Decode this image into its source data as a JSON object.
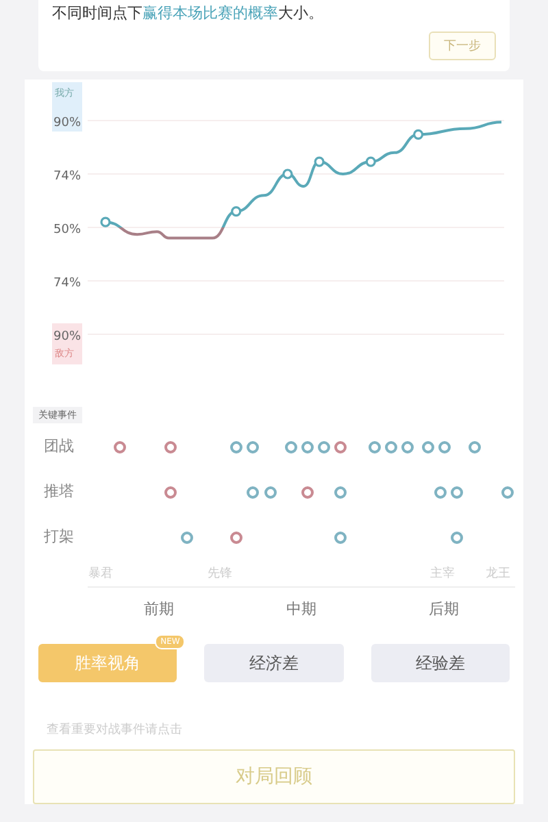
{
  "intro": {
    "text": "不同时间点下**赢得本场比赛的概率**大小。",
    "next_button": "下一步"
  },
  "win_chart": {
    "top_label": "我方",
    "bottom_label": "敌方",
    "axis_labels": [
      "90%",
      "74%",
      "50%",
      "74%",
      "90%"
    ]
  },
  "events": {
    "title": "关键事件",
    "rows": [
      {
        "label": "团战",
        "dots": [
          {
            "color": "#c98a92"
          },
          {
            "color": "#c98a92"
          },
          {
            "color": "#7fb3c2"
          },
          {
            "color": "#7fb3c2"
          },
          {
            "color": "#7fb3c2"
          },
          {
            "color": "#7fb3c2"
          },
          {
            "color": "#7fb3c2"
          },
          {
            "color": "#c98a92"
          },
          {
            "color": "#7fb3c2"
          },
          {
            "color": "#7fb3c2"
          },
          {
            "color": "#7fb3c2"
          },
          {
            "color": "#7fb3c2"
          },
          {
            "color": "#7fb3c2"
          },
          {
            "color": "#7fb3c2"
          }
        ]
      },
      {
        "label": "推塔",
        "dots": [
          {
            "color": "#c98a92"
          },
          {
            "color": "#7fb3c2"
          },
          {
            "color": "#7fb3c2"
          },
          {
            "color": "#c98a92"
          },
          {
            "color": "#7fb3c2"
          },
          {
            "color": "#7fb3c2"
          },
          {
            "color": "#7fb3c2"
          },
          {
            "color": "#7fb3c2"
          }
        ]
      },
      {
        "label": "打架",
        "dots": [
          {
            "color": "#7fb3c2"
          },
          {
            "color": "#c98a92"
          },
          {
            "color": "#7fb3c2"
          },
          {
            "color": "#7fb3c2"
          }
        ]
      }
    ],
    "objectives": [
      "暴君",
      "先锋",
      "主宰",
      "龙王"
    ],
    "phases": [
      "前期",
      "中期",
      "后期"
    ]
  },
  "modes": [
    {
      "label": "胜率视角",
      "badge": "NEW",
      "selected": true
    },
    {
      "label": "经济差",
      "selected": false
    },
    {
      "label": "经验差",
      "selected": false
    }
  ],
  "hint": "查看重要对战事件请点击",
  "review_button": "对局回顾"
}
